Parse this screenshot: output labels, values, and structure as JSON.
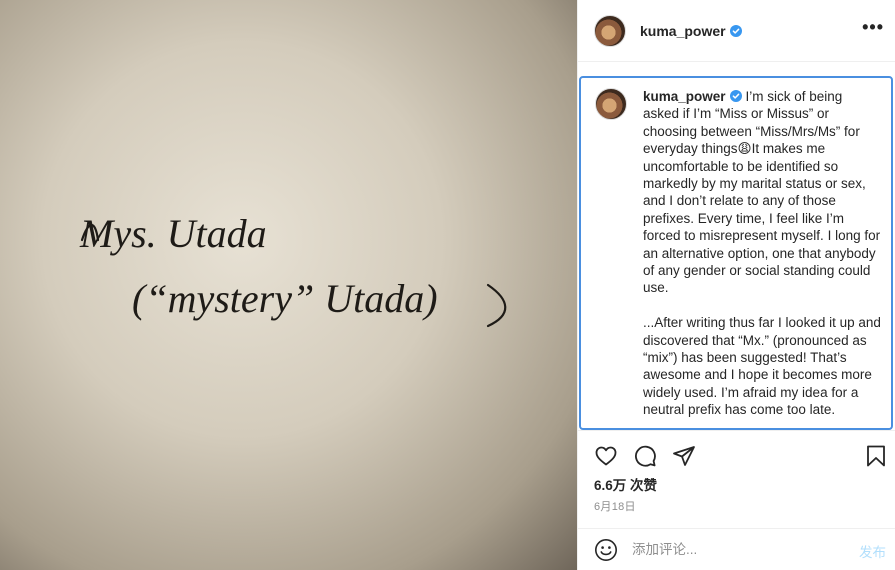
{
  "photo": {
    "line1": "Mys. Utada",
    "line2": "(“mystery” Utada)"
  },
  "header": {
    "username": "kuma_power",
    "avatar_icon": "avatar-image",
    "verified_icon": "verified-badge-icon",
    "more_icon": "more-options-icon",
    "more_label": "•••"
  },
  "caption": {
    "username": "kuma_power",
    "paragraph1": "I’m sick of being asked if I’m “Miss or Missus” or choosing between “Miss/Mrs/Ms” for everyday things😩It makes me uncomfortable to be identified so markedly by my marital status or sex, and I don’t relate to any of those prefixes. Every time, I feel like I’m forced to misrepresent myself. I long for an alternative option, one that anybody of any gender or social standing could use.",
    "paragraph2": "...After writing thus far I looked it up and discovered that “Mx.” (pronounced as “mix”) has been suggested! That’s awesome and I hope it becomes more widely used. I’m afraid my idea for a neutral prefix has come too late."
  },
  "actions": {
    "like_icon": "heart-icon",
    "comment_icon": "comment-icon",
    "share_icon": "share-icon",
    "save_icon": "bookmark-icon"
  },
  "likes": "6.6万 次赞",
  "date": "6月18日",
  "comment": {
    "emoji_icon": "emoji-icon",
    "placeholder": "添加评论...",
    "value": "",
    "post_label": "发布"
  },
  "colors": {
    "accent": "#0095f6",
    "post_disabled": "#b2dffc",
    "verified": "#3897f0",
    "focus_border": "#4a8fe0"
  }
}
